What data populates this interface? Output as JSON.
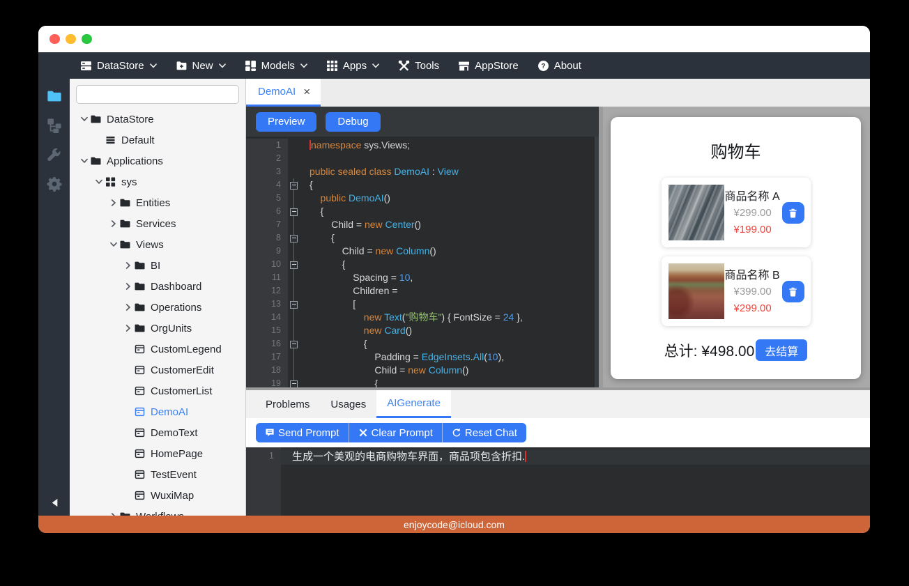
{
  "colors": {
    "accent_blue": "#3478f6",
    "selected_blue": "#3b82f6",
    "status_orange": "#cd6538",
    "price_red": "#f2453d",
    "price_gray": "#9a9a9a",
    "active_folder_blue": "#4fc3f7",
    "keyword_orange": "#d7863c",
    "type_cyan": "#45b3e8",
    "string_green": "#95c072",
    "number_blue": "#4e9cf0"
  },
  "menubar": {
    "items": [
      {
        "label": "DataStore",
        "icon": "datastore-icon",
        "chevron": true
      },
      {
        "label": "New",
        "icon": "new-folder-icon",
        "chevron": true
      },
      {
        "label": "Models",
        "icon": "models-icon",
        "chevron": true
      },
      {
        "label": "Apps",
        "icon": "apps-icon",
        "chevron": true
      },
      {
        "label": "Tools",
        "icon": "tools-icon",
        "chevron": false
      },
      {
        "label": "AppStore",
        "icon": "appstore-icon",
        "chevron": false
      },
      {
        "label": "About",
        "icon": "about-icon",
        "chevron": false
      }
    ]
  },
  "activitybar": {
    "items": [
      {
        "name": "explorer",
        "icon": "folder-icon",
        "active": true
      },
      {
        "name": "hierarchy",
        "icon": "hierarchy-icon",
        "active": false
      },
      {
        "name": "tools",
        "icon": "wrench-icon",
        "active": false
      },
      {
        "name": "settings",
        "icon": "gear-icon",
        "active": false
      }
    ]
  },
  "explorer": {
    "search": {
      "value": "",
      "placeholder": ""
    },
    "tree": [
      {
        "label": "DataStore",
        "level": 0,
        "icon": "folder",
        "arrow": "down",
        "selected": false
      },
      {
        "label": "Default",
        "level": 1,
        "icon": "table",
        "arrow": "none",
        "selected": false
      },
      {
        "label": "Applications",
        "level": 0,
        "icon": "folder",
        "arrow": "down",
        "selected": false
      },
      {
        "label": "sys",
        "level": 1,
        "icon": "app",
        "arrow": "down",
        "selected": false
      },
      {
        "label": "Entities",
        "level": 2,
        "icon": "folder",
        "arrow": "right",
        "selected": false
      },
      {
        "label": "Services",
        "level": 2,
        "icon": "folder",
        "arrow": "right",
        "selected": false
      },
      {
        "label": "Views",
        "level": 2,
        "icon": "folder",
        "arrow": "down",
        "selected": false
      },
      {
        "label": "BI",
        "level": 3,
        "icon": "folder",
        "arrow": "right",
        "selected": false
      },
      {
        "label": "Dashboard",
        "level": 3,
        "icon": "folder",
        "arrow": "right",
        "selected": false
      },
      {
        "label": "Operations",
        "level": 3,
        "icon": "folder",
        "arrow": "right",
        "selected": false
      },
      {
        "label": "OrgUnits",
        "level": 3,
        "icon": "folder",
        "arrow": "right",
        "selected": false
      },
      {
        "label": "CustomLegend",
        "level": 3,
        "icon": "view",
        "arrow": "none",
        "selected": false
      },
      {
        "label": "CustomerEdit",
        "level": 3,
        "icon": "view",
        "arrow": "none",
        "selected": false
      },
      {
        "label": "CustomerList",
        "level": 3,
        "icon": "view",
        "arrow": "none",
        "selected": false
      },
      {
        "label": "DemoAI",
        "level": 3,
        "icon": "view",
        "arrow": "none",
        "selected": true
      },
      {
        "label": "DemoText",
        "level": 3,
        "icon": "view",
        "arrow": "none",
        "selected": false
      },
      {
        "label": "HomePage",
        "level": 3,
        "icon": "view",
        "arrow": "none",
        "selected": false
      },
      {
        "label": "TestEvent",
        "level": 3,
        "icon": "view",
        "arrow": "none",
        "selected": false
      },
      {
        "label": "WuxiMap",
        "level": 3,
        "icon": "view",
        "arrow": "none",
        "selected": false
      },
      {
        "label": "Workflows",
        "level": 2,
        "icon": "folder",
        "arrow": "right",
        "selected": false
      }
    ]
  },
  "editor": {
    "tab": {
      "label": "DemoAI",
      "close": "×"
    },
    "toolbar": {
      "preview_label": "Preview",
      "debug_label": "Debug"
    },
    "code_lines": [
      {
        "n": "1",
        "fold": "",
        "tokens": [
          {
            "c": "caret",
            "t": ""
          },
          {
            "c": "kw",
            "t": "namespace"
          },
          {
            "c": "pl",
            "t": " sys.Views;"
          }
        ]
      },
      {
        "n": "2",
        "fold": "",
        "tokens": []
      },
      {
        "n": "3",
        "fold": "",
        "tokens": [
          {
            "c": "kw",
            "t": "public sealed class"
          },
          {
            "c": "ty",
            "t": " DemoAI"
          },
          {
            "c": "pl",
            "t": " : "
          },
          {
            "c": "ty",
            "t": "View"
          }
        ]
      },
      {
        "n": "4",
        "fold": "box",
        "tokens": [
          {
            "c": "pl",
            "t": "{"
          }
        ]
      },
      {
        "n": "5",
        "fold": "line",
        "tokens": [
          {
            "c": "kw",
            "t": "    public"
          },
          {
            "c": "ty",
            "t": " DemoAI"
          },
          {
            "c": "pl",
            "t": "()"
          }
        ]
      },
      {
        "n": "6",
        "fold": "box",
        "tokens": [
          {
            "c": "pl",
            "t": "    {"
          }
        ]
      },
      {
        "n": "7",
        "fold": "line",
        "tokens": [
          {
            "c": "pl",
            "t": "        Child = "
          },
          {
            "c": "kw",
            "t": "new"
          },
          {
            "c": "ty",
            "t": " Center"
          },
          {
            "c": "pl",
            "t": "()"
          }
        ]
      },
      {
        "n": "8",
        "fold": "box",
        "tokens": [
          {
            "c": "pl",
            "t": "        {"
          }
        ]
      },
      {
        "n": "9",
        "fold": "line",
        "tokens": [
          {
            "c": "pl",
            "t": "            Child = "
          },
          {
            "c": "kw",
            "t": "new"
          },
          {
            "c": "ty",
            "t": " Column"
          },
          {
            "c": "pl",
            "t": "()"
          }
        ]
      },
      {
        "n": "10",
        "fold": "box",
        "tokens": [
          {
            "c": "pl",
            "t": "            {"
          }
        ]
      },
      {
        "n": "11",
        "fold": "line",
        "tokens": [
          {
            "c": "pl",
            "t": "                Spacing = "
          },
          {
            "c": "num",
            "t": "10"
          },
          {
            "c": "pl",
            "t": ","
          }
        ]
      },
      {
        "n": "12",
        "fold": "line",
        "tokens": [
          {
            "c": "pl",
            "t": "                Children ="
          }
        ]
      },
      {
        "n": "13",
        "fold": "box",
        "tokens": [
          {
            "c": "pl",
            "t": "                ["
          }
        ]
      },
      {
        "n": "14",
        "fold": "line",
        "tokens": [
          {
            "c": "pl",
            "t": "                    "
          },
          {
            "c": "kw",
            "t": "new"
          },
          {
            "c": "ty",
            "t": " Text"
          },
          {
            "c": "pl",
            "t": "("
          },
          {
            "c": "str",
            "t": "\"购物车\""
          },
          {
            "c": "pl",
            "t": ") { FontSize = "
          },
          {
            "c": "num",
            "t": "24"
          },
          {
            "c": "pl",
            "t": " },"
          }
        ]
      },
      {
        "n": "15",
        "fold": "line",
        "tokens": [
          {
            "c": "pl",
            "t": "                    "
          },
          {
            "c": "kw",
            "t": "new"
          },
          {
            "c": "ty",
            "t": " Card"
          },
          {
            "c": "pl",
            "t": "()"
          }
        ]
      },
      {
        "n": "16",
        "fold": "box",
        "tokens": [
          {
            "c": "pl",
            "t": "                    {"
          }
        ]
      },
      {
        "n": "17",
        "fold": "line",
        "tokens": [
          {
            "c": "pl",
            "t": "                        Padding = "
          },
          {
            "c": "ty",
            "t": "EdgeInsets"
          },
          {
            "c": "pl",
            "t": "."
          },
          {
            "c": "ty",
            "t": "All"
          },
          {
            "c": "pl",
            "t": "("
          },
          {
            "c": "num",
            "t": "10"
          },
          {
            "c": "pl",
            "t": "),"
          }
        ]
      },
      {
        "n": "18",
        "fold": "line",
        "tokens": [
          {
            "c": "pl",
            "t": "                        Child = "
          },
          {
            "c": "kw",
            "t": "new"
          },
          {
            "c": "ty",
            "t": " Column"
          },
          {
            "c": "pl",
            "t": "()"
          }
        ]
      },
      {
        "n": "19",
        "fold": "box",
        "tokens": [
          {
            "c": "pl",
            "t": "                        {"
          }
        ]
      }
    ]
  },
  "preview": {
    "cart_title": "购物车",
    "items": [
      {
        "name": "商品名称 A",
        "original_price": "¥299.00",
        "discount_price": "¥199.00",
        "image": "water-texture"
      },
      {
        "name": "商品名称 B",
        "original_price": "¥399.00",
        "discount_price": "¥299.00",
        "image": "autumn-leaves"
      }
    ],
    "total_label": "总计: ¥498.00",
    "checkout_label": "去结算"
  },
  "bottom_panel": {
    "tabs": [
      {
        "label": "Problems",
        "active": false
      },
      {
        "label": "Usages",
        "active": false
      },
      {
        "label": "AIGenerate",
        "active": true
      }
    ],
    "buttons": [
      {
        "label": "Send Prompt",
        "icon": "chat-icon"
      },
      {
        "label": "Clear Prompt",
        "icon": "close-icon"
      },
      {
        "label": "Reset Chat",
        "icon": "reset-icon"
      }
    ],
    "prompt": {
      "line_number": "1",
      "text": "生成一个美观的电商购物车界面，商品项包含折扣."
    }
  },
  "statusbar": {
    "text": "enjoycode@icloud.com"
  }
}
